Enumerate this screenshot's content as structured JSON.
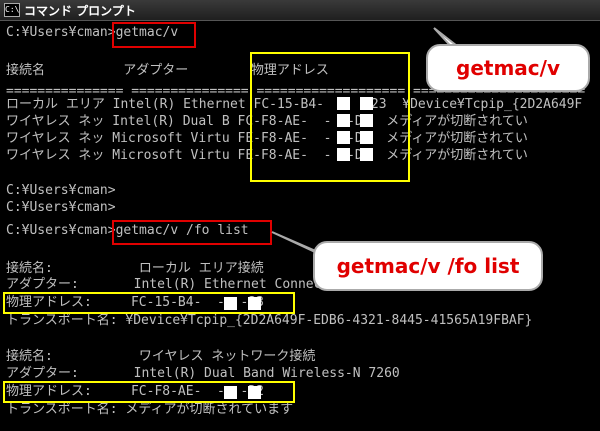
{
  "window": {
    "title": "コマンド プロンプト",
    "icon_label": "C:\\",
    "background": "#000000",
    "text_color": "#c0c0c0"
  },
  "console_lines": [
    "C:¥Users¥cman>getmac/v",
    "",
    "接続名          アダプター        物理アドレス",
    "=============== =============== =================== ======================",
    "ローカル エリア Intel(R) Ethernet FC-15-B4-  -  -23  ¥Device¥Tcpip_{2D2A649F",
    "ワイヤレス ネッ Intel(R) Dual B FC-F8-AE-  -  -D2  メディアが切断されてい",
    "ワイヤレス ネッ Microsoft Virtu FE-F8-AE-  -  -D3  メディアが切断されてい",
    "ワイヤレス ネッ Microsoft Virtu FE-F8-AE-  -  -D2  メディアが切断されてい",
    "",
    "C:¥Users¥cman>",
    "C:¥Users¥cman>",
    "C:¥Users¥cman>getmac/v /fo list",
    "",
    "接続名:           ローカル エリア接続",
    "アダプター:       Intel(R) Ethernet Connection I218-LM",
    "物理アドレス:     FC-15-B4-  -  -23",
    "トランスポート名: ¥Device¥Tcpip_{2D2A649F-EDB6-4321-8445-41565A19FBAF}",
    "",
    "接続名:           ワイヤレス ネットワーク接続",
    "アダプター:       Intel(R) Dual Band Wireless-N 7260",
    "物理アドレス:     FC-F8-AE-  -  -D2",
    "トランスポート名: メディアが切断されています"
  ],
  "callouts": {
    "first": "getmac/v",
    "second": "getmac/v /fo list"
  },
  "colors": {
    "highlight_red": "#e00000",
    "highlight_yellow": "#ffff00",
    "callout_text": "#e00000"
  }
}
